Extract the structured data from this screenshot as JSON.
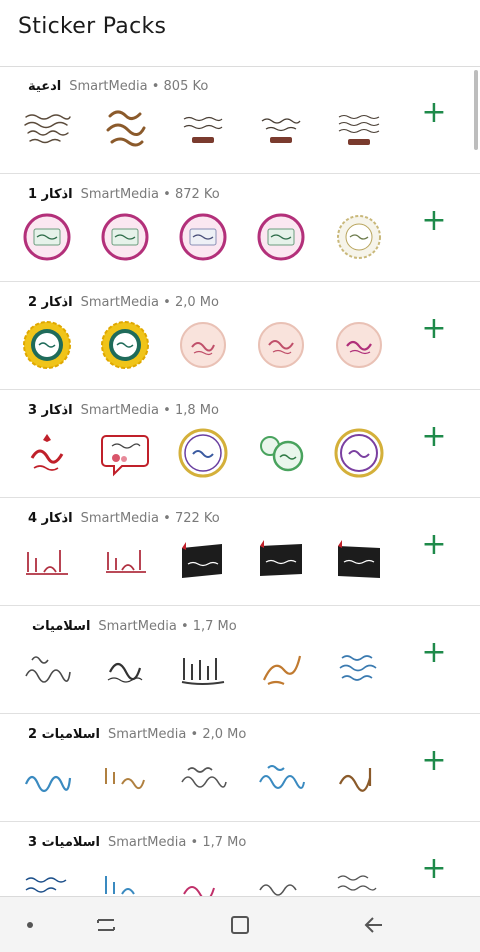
{
  "app": {
    "title": "Sticker Packs"
  },
  "packs": [
    {
      "name": "ادعية",
      "publisher": "SmartMedia",
      "size": "805 Ko",
      "kind": "text"
    },
    {
      "name": "اذكار 1",
      "publisher": "SmartMedia",
      "size": "872 Ko",
      "kind": "pink"
    },
    {
      "name": "اذكار 2",
      "publisher": "SmartMedia",
      "size": "2,0 Mo",
      "kind": "mixed"
    },
    {
      "name": "اذكار 3",
      "publisher": "SmartMedia",
      "size": "1,8 Mo",
      "kind": "floral"
    },
    {
      "name": "اذكار 4",
      "publisher": "SmartMedia",
      "size": "722 Ko",
      "kind": "banner"
    },
    {
      "name": "اسلاميات",
      "publisher": "SmartMedia",
      "size": "1,7 Mo",
      "kind": "calligraphy"
    },
    {
      "name": "اسلاميات 2",
      "publisher": "SmartMedia",
      "size": "2,0 Mo",
      "kind": "calligraphy2"
    },
    {
      "name": "اسلاميات 3",
      "publisher": "SmartMedia",
      "size": "1,7 Mo",
      "kind": "calligraphy3"
    }
  ],
  "separator": "•",
  "add_icon": "plus-icon",
  "colors": {
    "accent": "#1e8a4a",
    "divider": "#e0e0e0"
  },
  "navbar": {
    "items": [
      "dot-icon",
      "recent-apps-icon",
      "home-icon",
      "back-icon"
    ]
  }
}
